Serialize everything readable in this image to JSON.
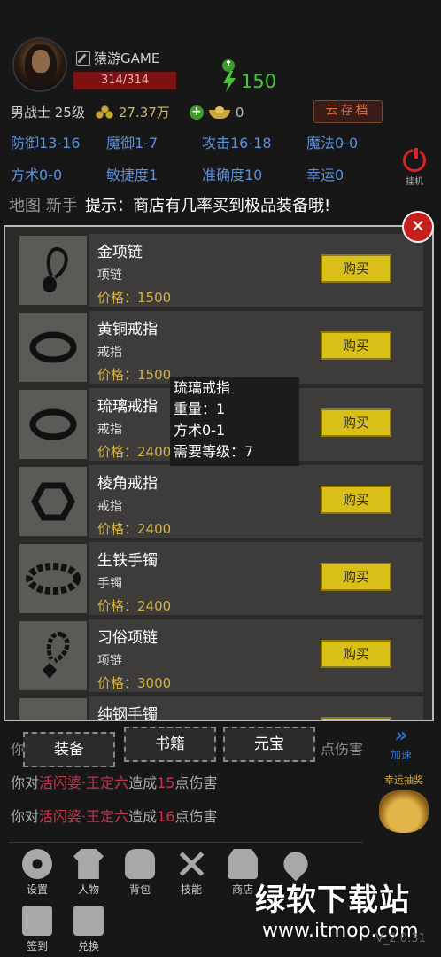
{
  "header": {
    "player_name": "猿游GAME",
    "hp": "314/314",
    "energy": "150",
    "class_level": "男战士 25级",
    "gold": "27.37万",
    "ingots": "0",
    "cloud_save": "云存档",
    "idle_label": "挂机"
  },
  "attributes": [
    "防御13-16",
    "魔御1-7",
    "攻击16-18",
    "魔法0-0",
    "方术0-0",
    "敏捷度1",
    "准确度10",
    "幸运0"
  ],
  "map_label": "地图 新手",
  "tip": "提示：商店有几率买到极品装备哦!",
  "shop": {
    "buy_label": "购买",
    "price_prefix": "价格：",
    "items": [
      {
        "name": "金项链",
        "type": "项链",
        "price": "价格：1500"
      },
      {
        "name": "黄铜戒指",
        "type": "戒指",
        "price": "价格：1500"
      },
      {
        "name": "琉璃戒指",
        "type": "戒指",
        "price": "价格：2400"
      },
      {
        "name": "棱角戒指",
        "type": "戒指",
        "price": "价格：2400"
      },
      {
        "name": "生铁手镯",
        "type": "手镯",
        "price": "价格：2400"
      },
      {
        "name": "习俗项链",
        "type": "项链",
        "price": "价格：3000"
      },
      {
        "name": "纯钢手镯",
        "type": "",
        "price": ""
      }
    ],
    "tooltip": {
      "name": "琉璃戒指",
      "weight": "重量：1",
      "attr": "方术0-1",
      "level": "需要等级：7"
    }
  },
  "categories": [
    "装备",
    "书籍",
    "元宝"
  ],
  "log": {
    "top_left": "你",
    "top_right": "点伤害",
    "lines": [
      {
        "prefix": "你对",
        "target": "活闪婆·王定六",
        "mid": "造成",
        "dmg": "15",
        "suffix": "点伤害"
      },
      {
        "prefix": "你对",
        "target": "活闪婆·王定六",
        "mid": "造成",
        "dmg": "16",
        "suffix": "点伤害"
      }
    ]
  },
  "side": {
    "speed": "加速",
    "lucky": "幸运抽奖"
  },
  "nav": [
    {
      "label": "设置",
      "icon": "gear-icon"
    },
    {
      "label": "人物",
      "icon": "shirt-icon"
    },
    {
      "label": "背包",
      "icon": "bag-icon"
    },
    {
      "label": "技能",
      "icon": "sword-icon"
    },
    {
      "label": "商店",
      "icon": "shop-icon"
    },
    {
      "label": "",
      "icon": "map-pin-icon"
    },
    {
      "label": "签到",
      "icon": "calendar-icon"
    },
    {
      "label": "兑换",
      "icon": "exchange-icon"
    }
  ],
  "watermark": "绿软下载站",
  "watermark_url": "www.itmop.com",
  "version": "V_2.0.31"
}
